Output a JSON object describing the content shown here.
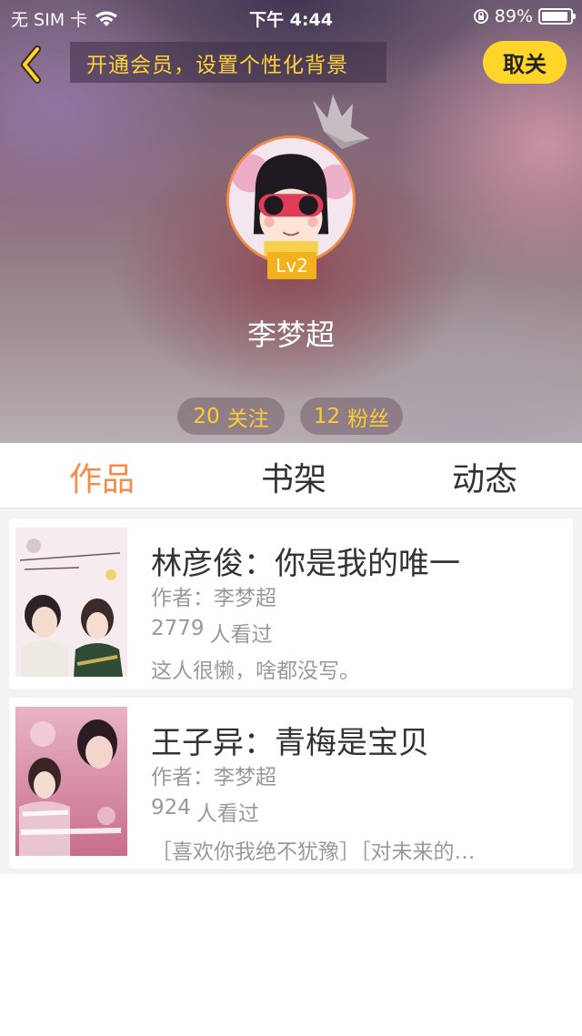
{
  "status_bar": {
    "carrier": "无 SIM 卡",
    "time": "下午 4:44",
    "battery": "89%"
  },
  "top_bar": {
    "vip_banner": "开通会员，设置个性化背景",
    "close_button": "取关"
  },
  "profile": {
    "level": "Lv2",
    "name": "李梦超",
    "following_count": "20",
    "following_label": "关注",
    "fans_count": "12",
    "fans_label": "粉丝"
  },
  "tabs": [
    {
      "label": "作品",
      "active": true
    },
    {
      "label": "书架",
      "active": false
    },
    {
      "label": "动态",
      "active": false
    }
  ],
  "books": [
    {
      "title": "林彦俊：你是我的唯一",
      "author": "作者：李梦超",
      "views_count": "2779",
      "views_label": "人看过",
      "description": "这人很懒，啥都没写。"
    },
    {
      "title": "王子异：青梅是宝贝",
      "author": "作者：李梦超",
      "views_count": "924",
      "views_label": "人看过",
      "description": "［喜欢你我绝不犹豫］［对未来的…"
    }
  ],
  "colors": {
    "accent_orange": "#f58c4a",
    "vip_yellow": "#ffd52a",
    "level_gold": "#f3b21c",
    "stat_text": "#ffcc33"
  }
}
